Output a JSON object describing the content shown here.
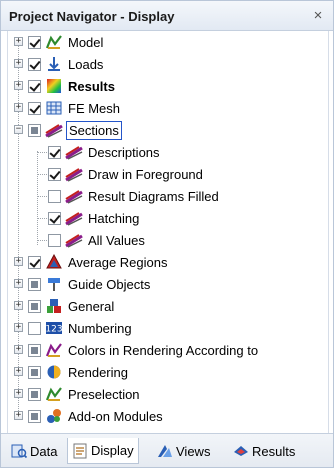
{
  "window": {
    "title": "Project Navigator - Display",
    "close_glyph": "×"
  },
  "tree": [
    {
      "label": "Model",
      "state": "checked",
      "icon": "model-icon",
      "expander": "+",
      "bold": false
    },
    {
      "label": "Loads",
      "state": "checked",
      "icon": "loads-icon",
      "expander": "+",
      "bold": false
    },
    {
      "label": "Results",
      "state": "checked",
      "icon": "results-icon",
      "expander": "+",
      "bold": true
    },
    {
      "label": "FE Mesh",
      "state": "checked",
      "icon": "fe-mesh-icon",
      "expander": "+",
      "bold": false
    },
    {
      "label": "Sections",
      "state": "partial",
      "icon": "sections-icon",
      "expander": "−",
      "bold": false,
      "selected": true,
      "children": [
        {
          "label": "Descriptions",
          "state": "checked",
          "icon": "sections-icon"
        },
        {
          "label": "Draw in Foreground",
          "state": "checked",
          "icon": "sections-icon"
        },
        {
          "label": "Result Diagrams Filled",
          "state": "unchecked",
          "icon": "sections-icon"
        },
        {
          "label": "Hatching",
          "state": "checked",
          "icon": "sections-icon"
        },
        {
          "label": "All Values",
          "state": "unchecked",
          "icon": "sections-icon"
        }
      ]
    },
    {
      "label": "Average Regions",
      "state": "checked",
      "icon": "average-regions-icon",
      "expander": "+",
      "bold": false
    },
    {
      "label": "Guide Objects",
      "state": "partial",
      "icon": "guide-objects-icon",
      "expander": "+",
      "bold": false
    },
    {
      "label": "General",
      "state": "partial",
      "icon": "general-icon",
      "expander": "+",
      "bold": false
    },
    {
      "label": "Numbering",
      "state": "unchecked",
      "icon": "numbering-icon",
      "expander": "+",
      "bold": false
    },
    {
      "label": "Colors in Rendering According to",
      "state": "partial",
      "icon": "colors-icon",
      "expander": "+",
      "bold": false
    },
    {
      "label": "Rendering",
      "state": "partial",
      "icon": "rendering-icon",
      "expander": "+",
      "bold": false
    },
    {
      "label": "Preselection",
      "state": "partial",
      "icon": "preselection-icon",
      "expander": "+",
      "bold": false
    },
    {
      "label": "Add-on Modules",
      "state": "partial",
      "icon": "addon-modules-icon",
      "expander": "+",
      "bold": false
    }
  ],
  "tabs": [
    {
      "label": "Data",
      "icon": "data-icon",
      "active": false
    },
    {
      "label": "Display",
      "icon": "display-icon",
      "active": true
    },
    {
      "label": "Views",
      "icon": "views-icon",
      "active": false
    },
    {
      "label": "Results",
      "icon": "results-tab-icon",
      "active": false
    }
  ],
  "colors": {
    "selection_border": "#2455c9",
    "frame": "#b9c6d8"
  }
}
